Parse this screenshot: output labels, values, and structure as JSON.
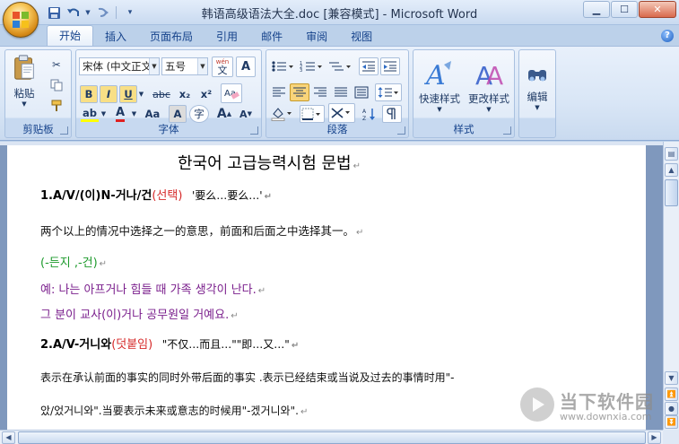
{
  "window": {
    "title": "韩语高级语法大全.doc [兼容模式] - Microsoft Word",
    "controls": [
      "minimize",
      "maximize",
      "close"
    ]
  },
  "quick_access": [
    "save-icon",
    "undo-icon",
    "redo-icon",
    "customize-icon"
  ],
  "tabs": [
    "开始",
    "插入",
    "页面布局",
    "引用",
    "邮件",
    "审阅",
    "视图"
  ],
  "active_tab": "开始",
  "ribbon": {
    "clipboard": {
      "label": "剪贴板",
      "paste": "粘贴"
    },
    "font": {
      "label": "字体",
      "font_name": "宋体 (中文正文)",
      "font_size": "五号",
      "wen_label": "wén",
      "wen_char": "文",
      "bold": "B",
      "italic": "I",
      "underline": "U",
      "strike": "abc",
      "sub": "x₂",
      "sup": "x²",
      "font_color": "A",
      "change_case": "Aa",
      "char_shading": "A",
      "enclose": "字",
      "grow": "A",
      "shrink": "A",
      "aA": "A",
      "char_border": "A"
    },
    "paragraph": {
      "label": "段落"
    },
    "styles": {
      "label": "样式",
      "quick_styles": "快速样式",
      "change_styles": "更改样式"
    },
    "editing": {
      "label": "编辑"
    }
  },
  "document": {
    "title": "한국어 고급능력시험 문법",
    "section1": {
      "heading": "1.A/V/(이)N-거나/건",
      "tag": "(선택)",
      "meaning": "'要么…要么…'",
      "desc": "两个以上的情况中选择之一的意思，前面和后面之中选择其一。",
      "variants": "(-든지 ,-건)",
      "example1": "예: 나는 아프거나 힘들 때 가족 생각이 난다.",
      "example2": "그 분이 교사(이)거나 공무원일 거예요."
    },
    "section2": {
      "heading": "2.A/V-거니와",
      "tag": "(덧붙임)",
      "meaning": "\"不仅…而且…\"\"即…又…\"",
      "desc1": "表示在承认前面的事实的同时外带后面的事实   .表示已经结束或当说及过去的事情时用\"-",
      "desc2": "았/었거니와\".当要表示未来或意志的时候用\"-겠거니와\"."
    },
    "para_mark": "↵"
  },
  "watermark": {
    "text": "当下软件园",
    "url": "www.downxia.com"
  },
  "colors": {
    "accent": "#15428b",
    "red_tag": "#d62a2a",
    "green_text": "#1d9a2c",
    "purple_text": "#7a1e8c"
  }
}
